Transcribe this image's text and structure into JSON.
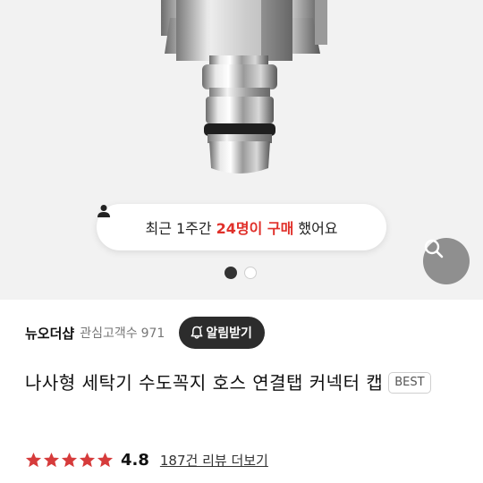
{
  "hero": {
    "purchase_notice": {
      "prefix": "최근 1주간",
      "highlight": "24명이 구매",
      "suffix": "했어요"
    },
    "carousel": {
      "total": 2,
      "active_index": 0
    }
  },
  "store": {
    "name": "뉴오더샵",
    "followers_label": "관심고객수",
    "followers_count": "971",
    "notify_label": "알림받기"
  },
  "product": {
    "title": "나사형 세탁기 수도꼭지 호스 연결탭 커넥터 캡",
    "badge": "BEST"
  },
  "rating": {
    "value": "4.8",
    "stars": 5,
    "star_color": "#d63b3b",
    "review_link": "187건 리뷰 더보기"
  },
  "colors": {
    "highlight": "#e0302a",
    "notify_bg": "#2c2c2c"
  },
  "icons": {
    "person": "person-icon",
    "zoom": "search-icon",
    "bell": "bell-icon",
    "star": "star-icon"
  }
}
